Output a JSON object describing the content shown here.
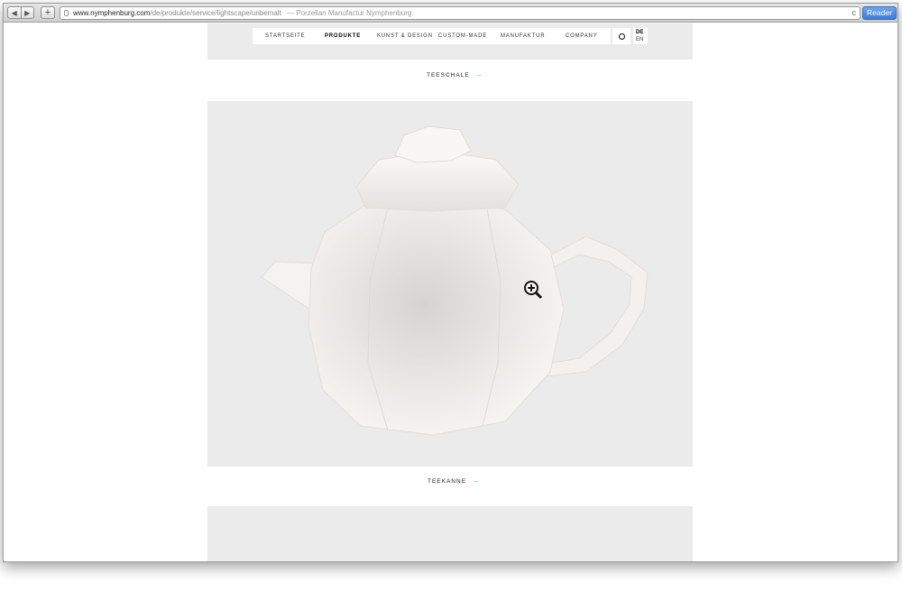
{
  "browser": {
    "back_icon": "◀",
    "forward_icon": "▶",
    "new_tab_icon": "+",
    "url_host": "www.nymphenburg.com",
    "url_path": "/de/produkte/service/lightscape/unbemalt",
    "page_title": "— Porzellan Manufactur Nymphenburg",
    "reload_icon": "c",
    "reader_label": "Reader"
  },
  "nav": {
    "items": [
      {
        "label": "STARTSEITE"
      },
      {
        "label": "PRODUKTE"
      },
      {
        "label": "KUNST & DESIGN"
      },
      {
        "label": "CUSTOM-MADE"
      },
      {
        "label": "MANUFAKTUR"
      },
      {
        "label": "COMPANY"
      }
    ],
    "lang_de": "DE",
    "lang_en": "EN"
  },
  "products": {
    "caption_1": "TEESCHALE",
    "caption_2": "TEEKANNE",
    "arrow": "→"
  },
  "colors": {
    "accent_arrow": "#2ec4d6",
    "panel_bg": "#ebebeb",
    "reader_blue": "#3d7bd9"
  }
}
